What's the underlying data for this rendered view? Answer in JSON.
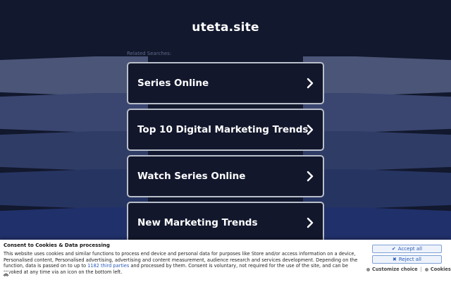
{
  "site": {
    "title": "uteta.site"
  },
  "related": {
    "label": "Related Searches:",
    "items": [
      {
        "label": "Series Online"
      },
      {
        "label": "Top 10 Digital Marketing Trends"
      },
      {
        "label": "Watch Series Online"
      },
      {
        "label": "New Marketing Trends"
      }
    ]
  },
  "consent": {
    "title": "Consent to Cookies & Data processing",
    "text_part1": "This website uses cookies and similar functions to process end device and personal data for purposes like Store and/or access information on a device, Personalised content, Personalised advertising, advertising and content measurement, audience research and services development. Depending on the function, data is passed on to up to ",
    "link": "1182 third parties",
    "text_part2": " and processed by them. Consent is voluntary, not required for the use of the site, and can be revoked at any time via an icon on the bottom left.",
    "accept_label": "Accept all",
    "reject_label": "Reject all",
    "customize_label": "Customize choice",
    "separator": "|",
    "cookies_label": "Cookies"
  },
  "colors": {
    "background": "#12182d",
    "card_border": "#b9bfca",
    "link": "#2a5bb8"
  }
}
